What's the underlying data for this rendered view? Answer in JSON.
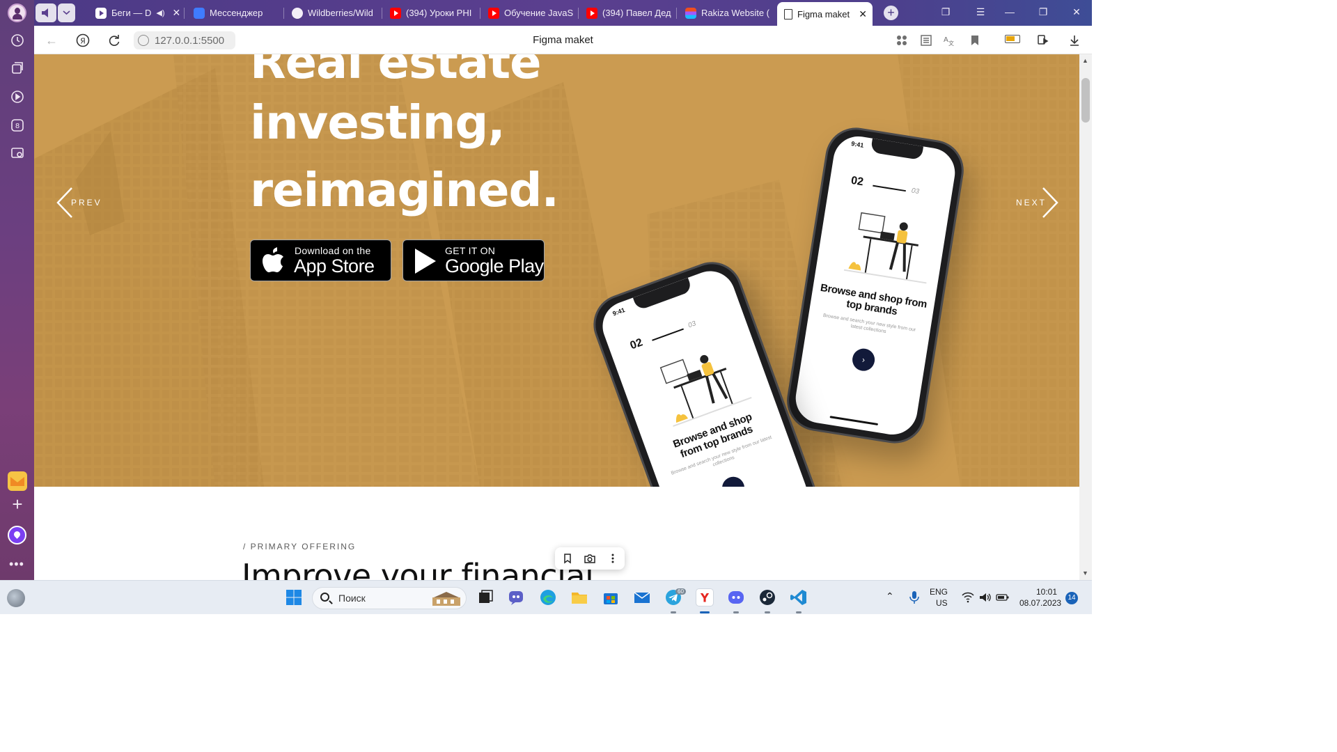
{
  "colors": {
    "hero_gold": "#c89a4e",
    "tab_strip": "#4c3a86",
    "sidebar": "#6b3f80",
    "store_button": "#000000",
    "phone_button": "#121a3a"
  },
  "browser": {
    "tabs": [
      {
        "title": "Беги — D",
        "icon": "play-icon",
        "muted_icon": "speaker-icon"
      },
      {
        "title": "Мессенджер",
        "icon": "messenger-icon"
      },
      {
        "title": "Wildberries/Wild",
        "icon": "github-icon"
      },
      {
        "title": "(394) Уроки PHI",
        "icon": "youtube-icon"
      },
      {
        "title": "Обучение JavaS",
        "icon": "youtube-icon"
      },
      {
        "title": "(394) Павел Дед",
        "icon": "youtube-icon"
      },
      {
        "title": "Rakiza Website (",
        "icon": "figma-icon"
      },
      {
        "title": "Figma maket",
        "icon": "document-icon",
        "active": true
      }
    ],
    "address": {
      "url": "127.0.0.1:5500",
      "page_title": "Figma maket"
    }
  },
  "hero": {
    "headline_lines": [
      "Real estate",
      "investing,",
      "reimagined."
    ],
    "carousel": {
      "prev_label": "PREV",
      "next_label": "NEXT"
    },
    "app_store": {
      "small": "Download on the",
      "big": "App Store"
    },
    "google_play": {
      "small": "GET IT ON",
      "big": "Google Play"
    },
    "phones": [
      {
        "time": "9:41",
        "pager_current": "02",
        "pager_next": "03",
        "title": "Browse and shop from top brands",
        "subtitle": "Browse and search your new style from our latest collections",
        "button_glyph": "›"
      },
      {
        "time": "9:41",
        "pager_current": "02",
        "pager_next": "03",
        "title": "Browse and shop from top brands",
        "subtitle": "Browse and search your new style from our latest collections",
        "button_glyph": "›"
      }
    ]
  },
  "offering": {
    "label": "/ PRIMARY OFFERING",
    "title": "Improve your financial"
  },
  "taskbar": {
    "search_placeholder": "Поиск",
    "telegram_badge": "60",
    "language": "ENG",
    "region": "US",
    "time": "10:01",
    "date": "08.07.2023",
    "notifications": "14"
  }
}
